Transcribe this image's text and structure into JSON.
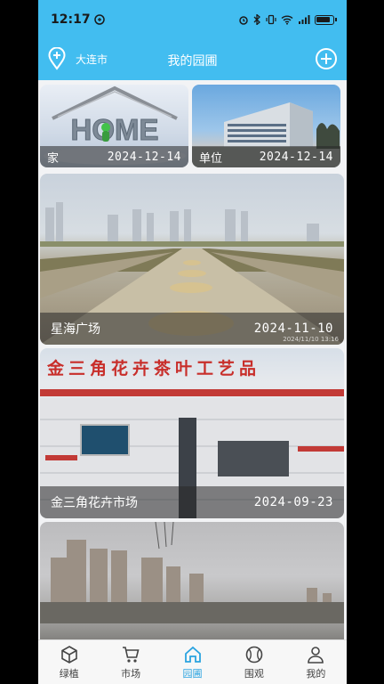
{
  "status": {
    "time": "12:17"
  },
  "header": {
    "city": "大连市",
    "title": "我的园圃"
  },
  "cards": [
    {
      "name": "家",
      "date": "2024-12-14",
      "image_text": "HOME"
    },
    {
      "name": "单位",
      "date": "2024-12-14"
    },
    {
      "name": "星海广场",
      "date": "2024-11-10",
      "watermark": "2024/11/10 13:16"
    },
    {
      "name": "金三角花卉市场",
      "date": "2024-09-23",
      "sign": "金三角花卉茶叶工艺品"
    },
    {
      "name": "",
      "date": ""
    }
  ],
  "tabs": [
    {
      "label": "绿植",
      "icon": "cube-icon"
    },
    {
      "label": "市场",
      "icon": "cart-icon"
    },
    {
      "label": "园圃",
      "icon": "home-icon",
      "active": true
    },
    {
      "label": "围观",
      "icon": "ball-icon"
    },
    {
      "label": "我的",
      "icon": "person-icon"
    }
  ],
  "colors": {
    "accent": "#42bdf0",
    "active_tab": "#2aa3e0"
  }
}
